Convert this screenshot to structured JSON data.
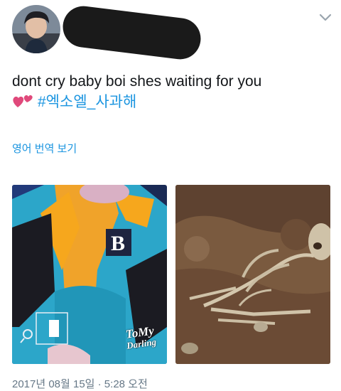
{
  "tweet": {
    "text": "dont cry baby boi shes waiting for you",
    "hashtag": "#엑소엘_사과해",
    "translate_label": "영어 번역 보기",
    "timestamp": "2017년 08월 15일 · 5:28 오전",
    "media": [
      {
        "label": "hoodie-photo",
        "watermark": "ToMy Darling"
      },
      {
        "label": "skeleton-photo"
      }
    ],
    "watermark_lines": [
      "ToMy",
      "Darling"
    ]
  },
  "colors": {
    "link": "#1b95e0",
    "text": "#14171a",
    "muted": "#657786",
    "heart": "#e0497b"
  }
}
